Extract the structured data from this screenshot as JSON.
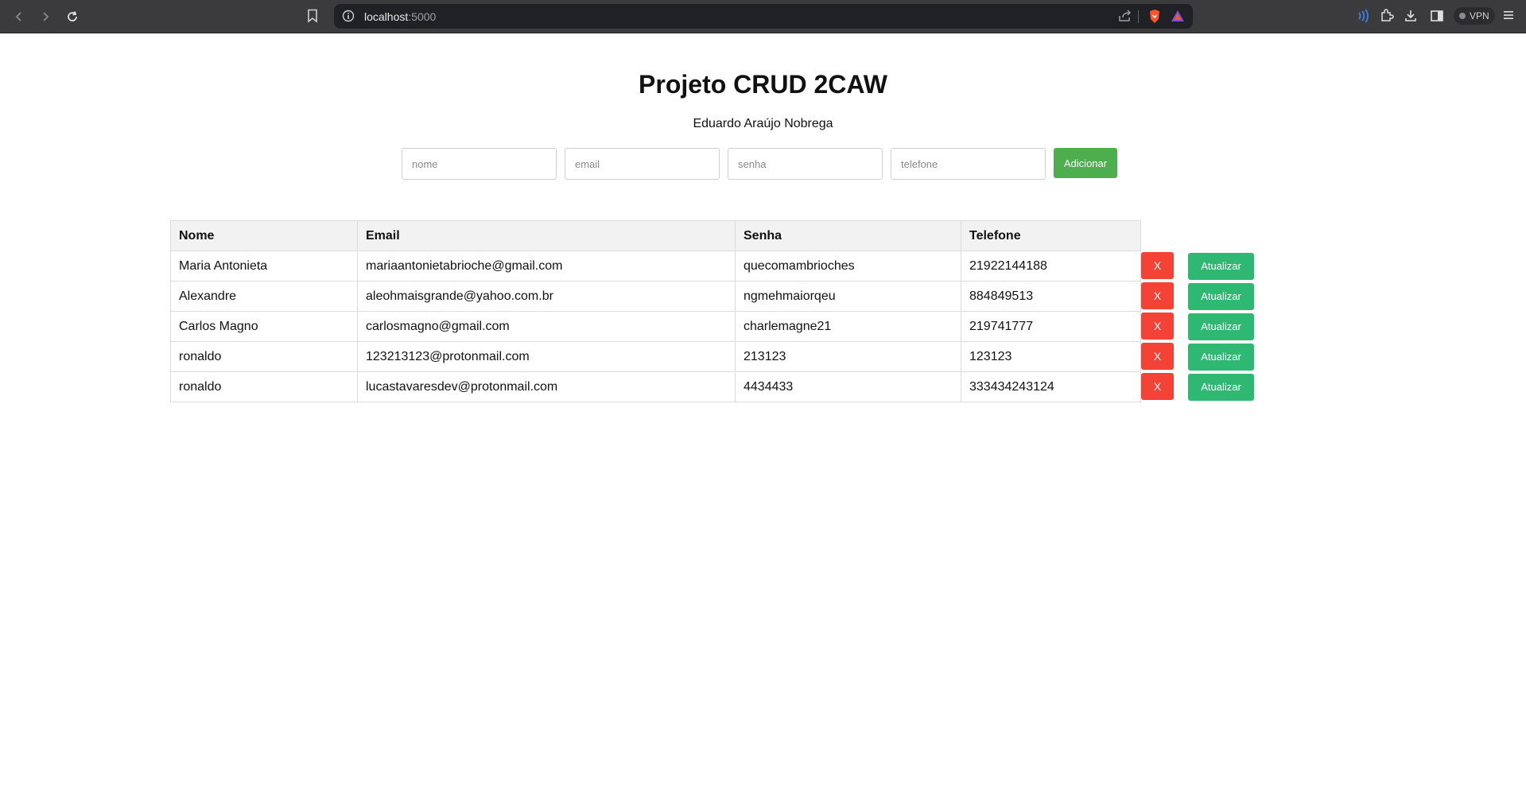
{
  "browser": {
    "url_host": "localhost",
    "url_port": ":5000",
    "vpn_label": "VPN"
  },
  "page": {
    "title": "Projeto CRUD 2CAW",
    "subtitle": "Eduardo Araújo Nobrega"
  },
  "form": {
    "nome_placeholder": "nome",
    "email_placeholder": "email",
    "senha_placeholder": "senha",
    "telefone_placeholder": "telefone",
    "add_label": "Adicionar",
    "add_color": "#4cae4c"
  },
  "table": {
    "headers": [
      "Nome",
      "Email",
      "Senha",
      "Telefone"
    ],
    "delete_label": "X",
    "update_label": "Atualizar",
    "delete_color": "#f44336",
    "update_color": "#2eb872",
    "rows": [
      {
        "nome": "Maria Antonieta",
        "email": "mariaantonietabrioche@gmail.com",
        "senha": "quecomambrioches",
        "telefone": "21922144188"
      },
      {
        "nome": "Alexandre",
        "email": "aleohmaisgrande@yahoo.com.br",
        "senha": "ngmehmaiorqeu",
        "telefone": "884849513"
      },
      {
        "nome": "Carlos Magno",
        "email": "carlosmagno@gmail.com",
        "senha": "charlemagne21",
        "telefone": "219741777"
      },
      {
        "nome": "ronaldo",
        "email": "123213123@protonmail.com",
        "senha": "213123",
        "telefone": "123123"
      },
      {
        "nome": "ronaldo",
        "email": "lucastavaresdev@protonmail.com",
        "senha": "4434433",
        "telefone": "333434243124"
      }
    ]
  }
}
